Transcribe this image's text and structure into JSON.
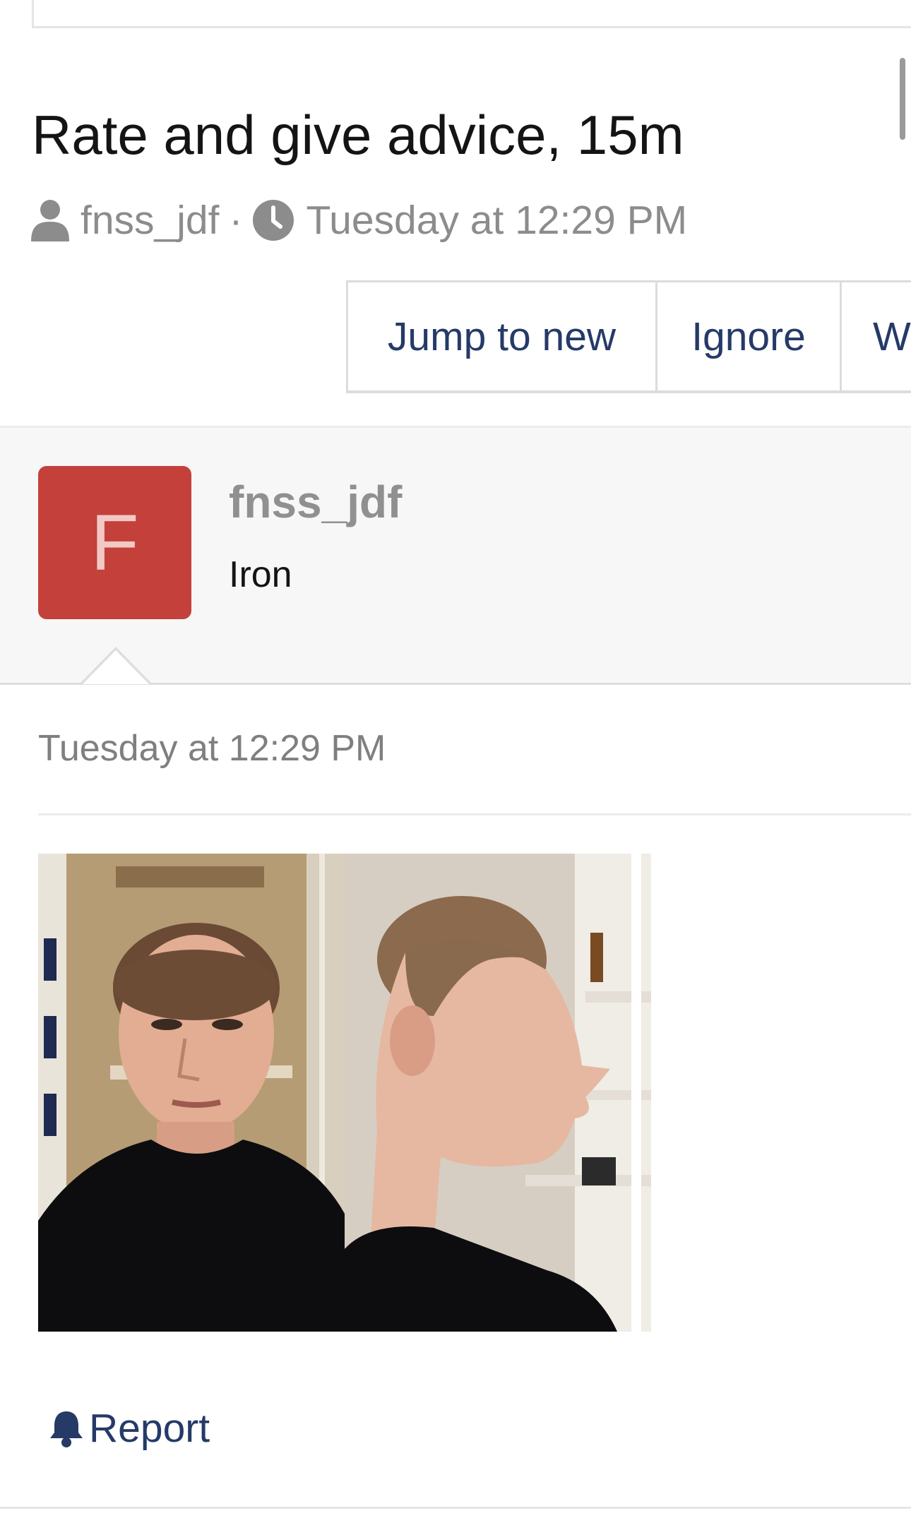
{
  "thread": {
    "title": "Rate and give advice, 15m",
    "author": "fnss_jdf",
    "separator": "·",
    "date": "Tuesday at 12:29 PM"
  },
  "actions": {
    "jump_to_new": "Jump to new",
    "ignore": "Ignore",
    "watch_partial": "Wa"
  },
  "post": {
    "avatar_letter": "F",
    "username": "fnss_jdf",
    "user_title": "Iron",
    "date": "Tuesday at 12:29 PM",
    "report_label": "Report"
  },
  "icons": {
    "author": "user-icon",
    "date": "clock-icon",
    "report": "bell-icon"
  },
  "colors": {
    "accent": "#253a67",
    "avatar_bg": "#c3413a",
    "muted": "#8c8c8c"
  }
}
